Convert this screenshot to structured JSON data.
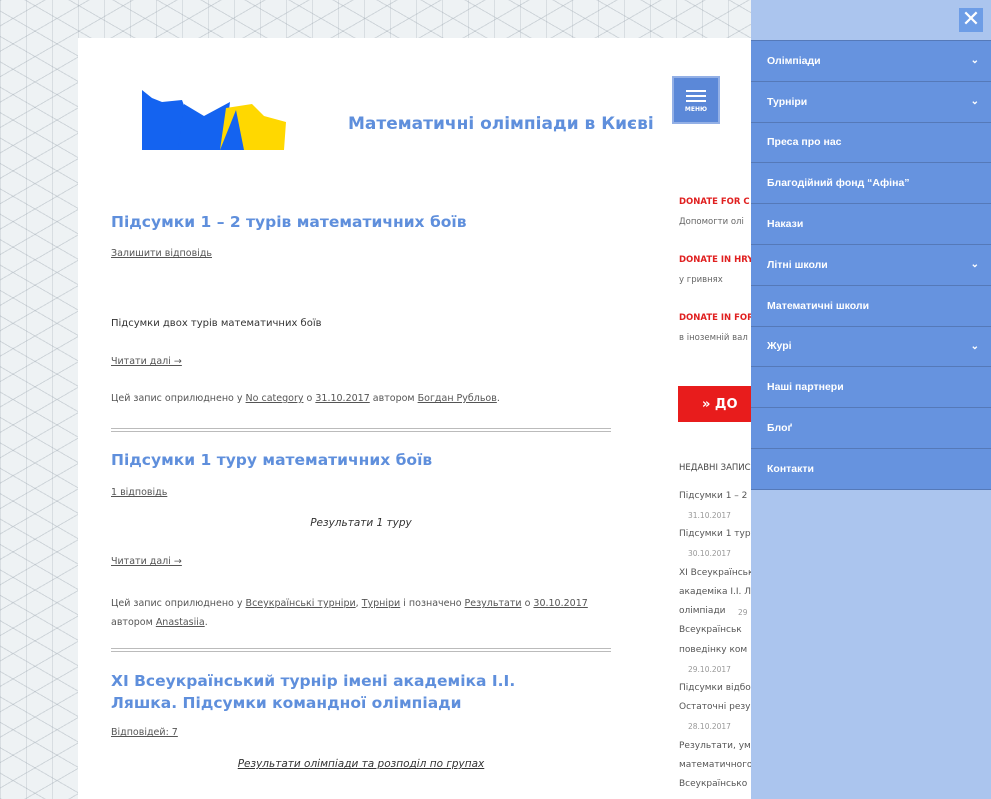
{
  "site": {
    "title": "Математичні олімпіади в Києві",
    "menu_label": "МЕНЮ"
  },
  "colors": {
    "accent": "#5f8fdc",
    "logo_blue": "#1463f0",
    "logo_yellow": "#ffd800",
    "donate_red": "#e81c1c",
    "menu_bg": "#6693df",
    "overlay_bg": "#abc5ee"
  },
  "posts": [
    {
      "title": "Підсумки 1 – 2 турів математичних боїв",
      "comments": "Залишити відповідь",
      "excerpt": "Підсумки двох турів математичних боїв",
      "read_more": "Читати далі →",
      "meta_prefix": "Цей запис оприлюднено у",
      "category": "No category",
      "meta_on": "о",
      "date": "31.10.2017",
      "meta_author_prefix": "автором",
      "author": "Богдан Рубльов",
      "meta_end": "."
    },
    {
      "title": "Підсумки 1 туру математичних боїв",
      "comments": "1 відповідь",
      "excerpt": "Результати 1 туру",
      "read_more": "Читати далі →",
      "meta_prefix": "Цей запис оприлюднено у",
      "category": "Всеукраїнські турніри",
      "category_sep": ",",
      "category2": "Турніри",
      "meta_tagged": "і позначено",
      "tag": "Результати",
      "meta_on": "о",
      "date": "30.10.2017",
      "meta_author_prefix": "автором",
      "author": "Anastasiia",
      "meta_end": "."
    },
    {
      "title": "XI Всеукраїнський турнір імені академіка І.І. Ляшка. Підсумки командної олімпіади",
      "comments": "Відповідей: 7",
      "excerpt": "Результати олімпіади та розподіл по групах"
    }
  ],
  "sidebar": {
    "donate": [
      {
        "heading": "DONATE FOR C",
        "sub": "Допомогти олі"
      },
      {
        "heading": "DONATE IN HRY",
        "sub": "у гривнях"
      },
      {
        "heading": "DONATE IN FOR",
        "sub": "в іноземній вал"
      }
    ],
    "donate_button": "» ДО",
    "recent_heading": "НЕДАВНІ ЗАПИСИ",
    "recent": [
      {
        "text": "Підсумки 1 – 2",
        "date": "31.10.2017"
      },
      {
        "text": "Підсумки 1 туру",
        "date": "30.10.2017"
      },
      {
        "text": "XI Всеукраїнськ",
        "text2": "академіка І.І. Л",
        "text3": "олімпіади",
        "date": "29"
      },
      {
        "text": "Всеукраїнськ",
        "text2": "поведінку ком",
        "date": "29.10.2017"
      },
      {
        "text": "Підсумки відбо",
        "text2": "Остаточні резу",
        "date": "28.10.2017"
      },
      {
        "text": "Результати, ум",
        "text2": "математичного",
        "text3": "Всеукраїнсько"
      }
    ]
  },
  "menu": {
    "close_icon": "close-icon",
    "items": [
      {
        "label": "Олімпіади",
        "has_sub": true
      },
      {
        "label": "Турніри",
        "has_sub": true
      },
      {
        "label": "Преса про нас",
        "has_sub": false
      },
      {
        "label": "Благодійний фонд “Афіна”",
        "has_sub": false
      },
      {
        "label": "Накази",
        "has_sub": false
      },
      {
        "label": "Літні школи",
        "has_sub": true
      },
      {
        "label": "Математичні школи",
        "has_sub": false
      },
      {
        "label": "Журі",
        "has_sub": true
      },
      {
        "label": "Наші партнери",
        "has_sub": false
      },
      {
        "label": "Блоґ",
        "has_sub": false
      },
      {
        "label": "Контакти",
        "has_sub": false
      }
    ]
  }
}
